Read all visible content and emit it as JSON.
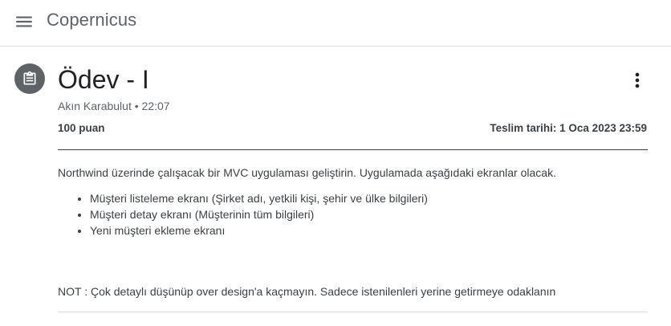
{
  "app": {
    "title": "Copernicus"
  },
  "icons": {
    "menu": "menu-icon",
    "assignment": "assignment-icon",
    "more": "more-vert-icon"
  },
  "assignment": {
    "title": "Ödev - I",
    "author": "Akın Karabulut",
    "separator": " • ",
    "time": "22:07",
    "points": "100 puan",
    "due": "Teslim tarihi: 1 Oca 2023 23:59",
    "description": "Northwind üzerinde çalışacak bir MVC uygulaması geliştirin. Uygulamada aşağıdaki ekranlar olacak.",
    "items": [
      "Müşteri listeleme ekranı (Şirket adı, yetkili kişi, şehir ve ülke bilgileri)",
      "Müşteri detay ekranı (Müşterinin tüm bilgileri)",
      "Yeni müşteri ekleme ekranı"
    ],
    "note": "NOT : Çok detaylı düşünüp over design'a kaçmayın. Sadece istenilenleri yerine getirmeye odaklanın"
  },
  "colors": {
    "icon_circle": "#5f6368",
    "title_text": "#202124",
    "body_text": "#3c4043",
    "divider": "#3c4043"
  }
}
